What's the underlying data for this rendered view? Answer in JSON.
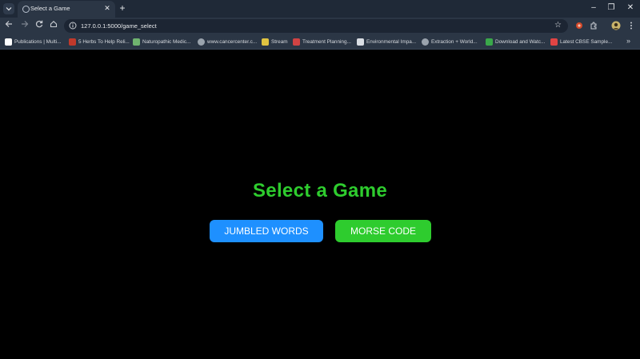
{
  "browser": {
    "tab_title": "Select a Game",
    "url": "127.0.0.1:5000/game_select",
    "bookmarks": [
      {
        "label": "Publications | Multi...",
        "icon_color": "#ffffff"
      },
      {
        "label": "5 Herbs To Help Reli...",
        "icon_color": "#c0392b"
      },
      {
        "label": "Naturopathic Medic...",
        "icon_color": "#6fb36f"
      },
      {
        "label": "www.cancercenter.c...",
        "icon_color": "#9aa3ad"
      },
      {
        "label": "Stream",
        "icon_color": "#e0c341"
      },
      {
        "label": "Treatment Planning...",
        "icon_color": "#d04343"
      },
      {
        "label": "Environmental Impa...",
        "icon_color": "#d9dde3"
      },
      {
        "label": "Extraction + World...",
        "icon_color": "#9aa3ad"
      },
      {
        "label": "Download and Watc...",
        "icon_color": "#3aa84a"
      },
      {
        "label": "Latest CBSE Sample...",
        "icon_color": "#e04444"
      }
    ]
  },
  "page": {
    "title": "Select a Game",
    "buttons": {
      "jumbled_words": "JUMBLED WORDS",
      "morse_code": "MORSE CODE"
    }
  },
  "colors": {
    "title_green": "#2ecc2e",
    "jumbled_blue": "#1e90ff",
    "morse_green": "#2ecc2e",
    "background": "#000000"
  }
}
